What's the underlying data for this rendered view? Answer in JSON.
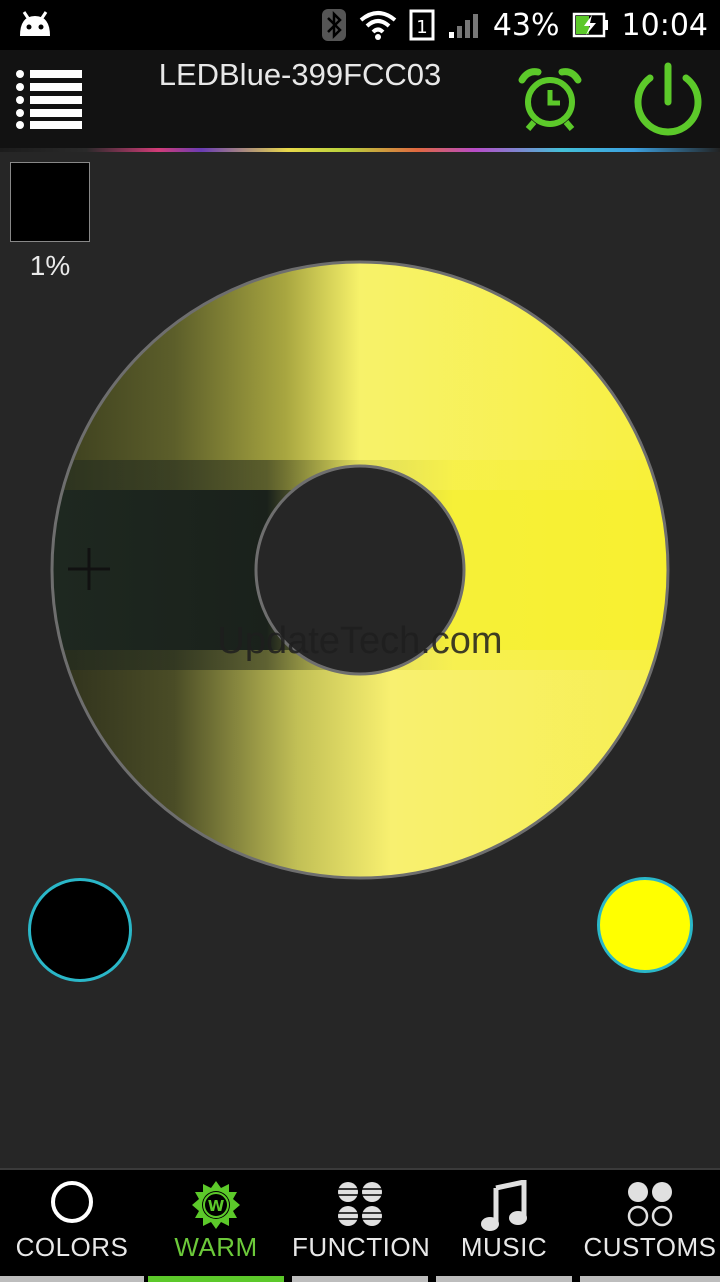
{
  "status_bar": {
    "battery_percent": "43%",
    "time": "10:04",
    "sim_slot": "1"
  },
  "app_bar": {
    "title": "LEDBlue-399FCC03"
  },
  "brightness": {
    "percent_label": "1%"
  },
  "watermark": "UpdateTech.com",
  "colors": {
    "accent": "#5cc92a",
    "ring_border": "#2ab7c8",
    "left_color": "#000000",
    "right_color": "#ffff00"
  },
  "tabs": [
    {
      "label": "COLORS",
      "icon": "circle-outline-icon",
      "active": false
    },
    {
      "label": "WARM",
      "icon": "warm-sun-w-icon",
      "active": true
    },
    {
      "label": "FUNCTION",
      "icon": "function-dots-icon",
      "active": false
    },
    {
      "label": "MUSIC",
      "icon": "music-note-icon",
      "active": false
    },
    {
      "label": "CUSTOMS",
      "icon": "customs-circles-icon",
      "active": false
    }
  ]
}
